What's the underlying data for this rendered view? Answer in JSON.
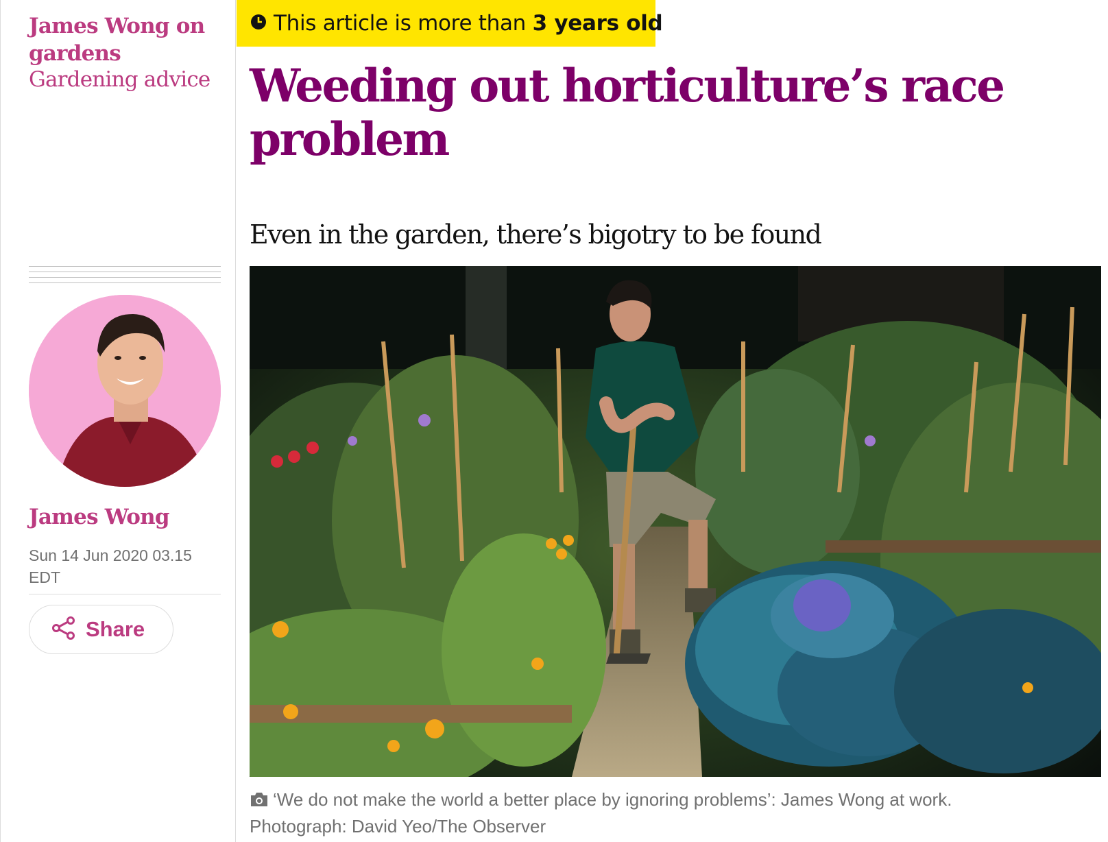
{
  "series": {
    "title": "James Wong on gardens",
    "subtitle": "Gardening advice"
  },
  "age_warning": {
    "prefix": "This article is more than ",
    "emphasis": "3 years old",
    "icon": "clock-icon"
  },
  "article": {
    "headline": "Weeding out horticulture’s race problem",
    "standfirst": "Even in the garden, there’s bigotry to be found"
  },
  "byline": {
    "name": "James Wong",
    "date": "Sun 14 Jun 2020 03.15 EDT"
  },
  "share": {
    "label": "Share",
    "icon": "share-icon"
  },
  "caption": {
    "icon": "camera-icon",
    "text": "‘We do not make the world a better place by ignoring problems’: James Wong at work.",
    "credit": "Photograph: David Yeo/The Observer"
  },
  "colors": {
    "accent": "#bb3b80",
    "headline": "#7d0068",
    "badge": "#ffe500",
    "muted": "#707070"
  }
}
